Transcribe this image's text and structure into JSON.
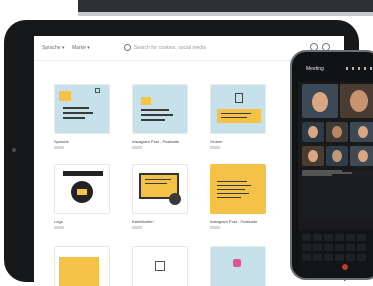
{
  "toolbar": {
    "filter_label": "Sprache ▾",
    "sort_label": "Marke ▾",
    "search_placeholder": "Search for cookies, social media"
  },
  "cards": [
    {
      "caption": "Sprache",
      "sub": "Ordner"
    },
    {
      "caption": "Instagram Post - Postkarte",
      "sub": "Ordner"
    },
    {
      "caption": "Ordner",
      "sub": "Ordner"
    },
    {
      "caption": "Logo",
      "sub": "Ordner"
    },
    {
      "caption": "Karteikarten",
      "sub": "Ordner"
    },
    {
      "caption": "Instagram Post - Postkarte",
      "sub": "Ordner"
    }
  ],
  "phone": {
    "title": "Meeting"
  },
  "colors": {
    "tablet_body": "#17181a",
    "screen_bg": "#ffffff",
    "thumb_blue": "#c7e1ea",
    "thumb_yellow": "#f4c247",
    "phone_body": "#111214"
  }
}
